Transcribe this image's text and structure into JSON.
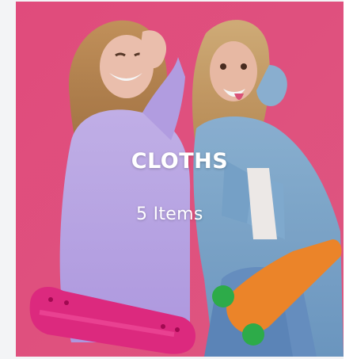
{
  "category_card": {
    "title": "CLOTHS",
    "item_count": "5 Items",
    "background_color": "#e9517f",
    "photo_subject": "two-girls-with-skateboards-photo"
  }
}
